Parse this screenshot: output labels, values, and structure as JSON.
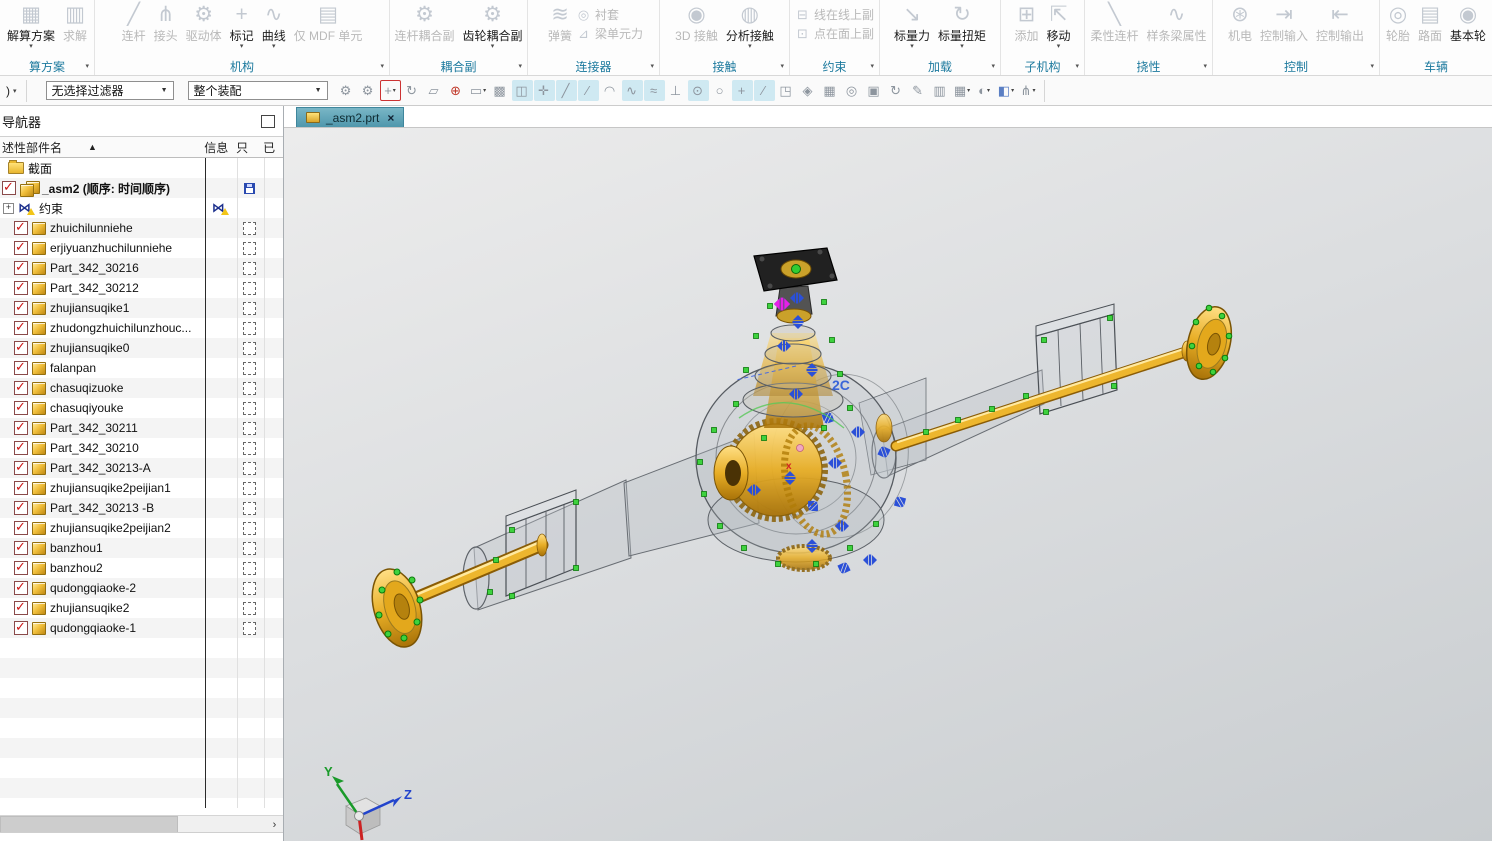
{
  "ribbon": {
    "groups": [
      {
        "label": "算方案",
        "items": [
          {
            "label": "解算方案",
            "icon": "solution-scheme-icon",
            "glyph": "▦",
            "enabled": true,
            "arrow": true
          },
          {
            "label": "求解",
            "icon": "solve-icon",
            "glyph": "▥",
            "enabled": false
          }
        ]
      },
      {
        "label": "机构",
        "items": [
          {
            "label": "连杆",
            "icon": "link-icon",
            "glyph": "╱",
            "enabled": false
          },
          {
            "label": "接头",
            "icon": "joint-icon",
            "glyph": "⋔",
            "enabled": false
          },
          {
            "label": "驱动体",
            "icon": "driver-icon",
            "glyph": "⚙",
            "enabled": false
          },
          {
            "label": "标记",
            "icon": "marker-icon",
            "glyph": "+",
            "enabled": true,
            "arrow": true
          },
          {
            "label": "曲线",
            "icon": "curve-icon",
            "glyph": "∿",
            "enabled": true,
            "arrow": true
          },
          {
            "label": "仅 MDF 单元",
            "icon": "mdf-only-icon",
            "glyph": "▤",
            "enabled": false
          }
        ]
      },
      {
        "label": "耦合副",
        "items": [
          {
            "label": "连杆耦合副",
            "icon": "link-coupler-icon",
            "glyph": "⚙",
            "enabled": false
          },
          {
            "label": "齿轮耦合副",
            "icon": "gear-coupler-icon",
            "glyph": "⚙",
            "enabled": true,
            "arrow": true
          }
        ]
      },
      {
        "label": "连接器",
        "items": [
          {
            "label": "弹簧",
            "icon": "spring-icon",
            "glyph": "≋",
            "enabled": false
          },
          {
            "label": "衬套",
            "icon": "bushing-icon",
            "glyph": "◎",
            "enabled": false
          },
          {
            "label": "梁单元力",
            "icon": "beam-force-icon",
            "glyph": "⊿",
            "enabled": false
          }
        ]
      },
      {
        "label": "接触",
        "items": [
          {
            "label": "3D 接触",
            "icon": "contact-3d-icon",
            "glyph": "◉",
            "enabled": false
          },
          {
            "label": "分析接触",
            "icon": "analysis-contact-icon",
            "glyph": "◍",
            "enabled": true,
            "arrow": true
          }
        ]
      },
      {
        "label": "约束",
        "items": [
          {
            "label": "线在线上副",
            "icon": "curve-on-curve-icon",
            "glyph": "⊟",
            "enabled": false
          },
          {
            "label": "点在面上副",
            "icon": "point-on-surface-icon",
            "glyph": "⊡",
            "enabled": false
          }
        ]
      },
      {
        "label": "加载",
        "items": [
          {
            "label": "标量力",
            "icon": "scalar-force-icon",
            "glyph": "↘",
            "enabled": true,
            "arrow": true
          },
          {
            "label": "标量扭矩",
            "icon": "scalar-torque-icon",
            "glyph": "↻",
            "enabled": true,
            "arrow": true
          }
        ]
      },
      {
        "label": "子机构",
        "items": [
          {
            "label": "添加",
            "icon": "add-icon",
            "glyph": "⊞",
            "enabled": false
          },
          {
            "label": "移动",
            "icon": "move-icon",
            "glyph": "⇱",
            "enabled": true,
            "arrow": true
          }
        ]
      },
      {
        "label": "挠性",
        "items": [
          {
            "label": "柔性连杆",
            "icon": "flexible-link-icon",
            "glyph": "╲",
            "enabled": false
          },
          {
            "label": "样条梁属性",
            "icon": "spline-beam-icon",
            "glyph": "∿",
            "enabled": false
          }
        ]
      },
      {
        "label": "控制",
        "items": [
          {
            "label": "机电",
            "icon": "mechatronics-icon",
            "glyph": "⊛",
            "enabled": false
          },
          {
            "label": "控制输入",
            "icon": "control-input-icon",
            "glyph": "⇥",
            "enabled": false
          },
          {
            "label": "控制输出",
            "icon": "control-output-icon",
            "glyph": "⇤",
            "enabled": false
          }
        ]
      },
      {
        "label": "车辆",
        "items": [
          {
            "label": "轮胎",
            "icon": "tire-icon",
            "glyph": "◎",
            "enabled": false
          },
          {
            "label": "路面",
            "icon": "road-icon",
            "glyph": "▤",
            "enabled": false
          },
          {
            "label": "基本轮",
            "icon": "basic-wheel-icon",
            "glyph": "◉",
            "enabled": true
          }
        ]
      }
    ]
  },
  "toolbar": {
    "menu_partial": ")",
    "filter_select": "无选择过滤器",
    "scope_select": "整个装配",
    "buttons": [
      {
        "name": "assembly-constraints-icon",
        "glyph": "⚙"
      },
      {
        "name": "move-component-icon",
        "glyph": "⚙"
      },
      {
        "name": "snap-filter-icon",
        "glyph": "+",
        "cls": "red",
        "arrow": "▾"
      },
      {
        "name": "rotate-reuse-icon",
        "glyph": "↻"
      },
      {
        "name": "copy-icon",
        "glyph": "▱"
      },
      {
        "name": "wcs-dynamics-icon",
        "glyph": "⊕",
        "cls": "redglyph"
      },
      {
        "name": "marquee-select-icon",
        "glyph": "▭",
        "arrow": "▾"
      },
      {
        "name": "dice-icon",
        "glyph": "▩"
      },
      {
        "name": "snap-box-icon",
        "glyph": "◫",
        "cls": "active"
      },
      {
        "name": "snap-handles-icon",
        "glyph": "✛",
        "cls": "active"
      },
      {
        "name": "snap-endpoint-icon",
        "glyph": "╱",
        "cls": "active"
      },
      {
        "name": "snap-midpoint-icon",
        "glyph": "∕",
        "cls": "active"
      },
      {
        "name": "snap-curve-icon",
        "glyph": "◠"
      },
      {
        "name": "snap-spline-point-icon",
        "glyph": "∿",
        "cls": "active"
      },
      {
        "name": "snap-curve-on-curve-icon",
        "glyph": "≈",
        "cls": "active"
      },
      {
        "name": "snap-pole-icon",
        "glyph": "⊥"
      },
      {
        "name": "snap-arc-center-icon",
        "glyph": "⊙",
        "cls": "active"
      },
      {
        "name": "snap-quadrant-icon",
        "glyph": "○"
      },
      {
        "name": "snap-intersection-icon",
        "glyph": "+",
        "cls": "active"
      },
      {
        "name": "snap-point-on-line-icon",
        "glyph": "⁄",
        "cls": "active"
      },
      {
        "name": "snap-point-on-face-icon",
        "glyph": "◳"
      },
      {
        "name": "snap-facet-icon",
        "glyph": "◈"
      },
      {
        "name": "snap-grid-icon",
        "glyph": "▦"
      },
      {
        "name": "zoom-region-icon",
        "glyph": "◎"
      },
      {
        "name": "snapshot-icon",
        "glyph": "▣"
      },
      {
        "name": "refresh-icon",
        "glyph": "↻"
      },
      {
        "name": "annotate-icon",
        "glyph": "✎"
      },
      {
        "name": "sheets-icon",
        "glyph": "▥"
      },
      {
        "name": "window-layout-icon",
        "glyph": "▦",
        "arrow": "▾"
      },
      {
        "name": "render-style-icon",
        "glyph": "◐",
        "arrow": "▾"
      },
      {
        "name": "view-cube-icon",
        "glyph": "◧",
        "cls": "blue",
        "arrow": "▾"
      },
      {
        "name": "orient-view-icon",
        "glyph": "⋔",
        "arrow": "▾"
      }
    ]
  },
  "tab": {
    "label": "_asm2.prt",
    "close": "×"
  },
  "navigator": {
    "title": "导航器",
    "columns": {
      "name": "述性部件名",
      "sort": "▲",
      "info": "信息",
      "readonly": "只",
      "loaded": "已"
    },
    "section_label": "截面",
    "assembly_label": "_asm2 (顺序: 时间顺序)",
    "constraints_label": "约束",
    "constraints_expander": "+",
    "parts": [
      {
        "name": "zhuichilunniehe"
      },
      {
        "name": "erjiyuanzhuchilunniehe"
      },
      {
        "name": "Part_342_30216"
      },
      {
        "name": "Part_342_30212"
      },
      {
        "name": "zhujiansuqike1"
      },
      {
        "name": "zhudongzhuichilunzhouc..."
      },
      {
        "name": "zhujiansuqike0"
      },
      {
        "name": "falanpan"
      },
      {
        "name": "chasuqizuoke"
      },
      {
        "name": "chasuqiyouke"
      },
      {
        "name": "Part_342_30211"
      },
      {
        "name": "Part_342_30210"
      },
      {
        "name": "Part_342_30213-A"
      },
      {
        "name": "zhujiansuqike2peijian1"
      },
      {
        "name": "Part_342_30213 -B"
      },
      {
        "name": "zhujiansuqike2peijian2"
      },
      {
        "name": "banzhou1"
      },
      {
        "name": "banzhou2"
      },
      {
        "name": "qudongqiaoke-2"
      },
      {
        "name": "zhujiansuqike2"
      },
      {
        "name": "qudongqiaoke-1"
      }
    ],
    "scroll_arrow": "›"
  },
  "viewport": {
    "constraint_label": "2C",
    "origin_mark": "x",
    "triad": {
      "y": "Y",
      "z": "Z"
    },
    "colors": {
      "gold": "#e8ae26",
      "green": "#3ed23e",
      "constraint_blue": "#2b50d8",
      "magenta": "#e620e6",
      "tab_teal": "#4f97ac"
    }
  }
}
